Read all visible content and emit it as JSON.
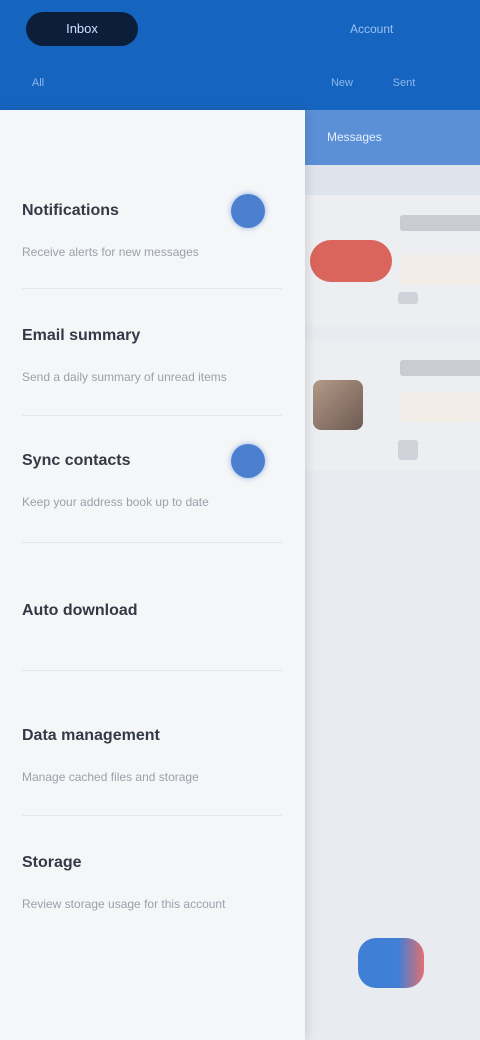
{
  "appbar": {
    "pill_label": "Inbox",
    "right_title": "Account",
    "subtabs": [
      "All",
      "New",
      "Sent"
    ]
  },
  "settings": [
    {
      "title": "Notifications",
      "desc": "Receive alerts for new messages",
      "toggle": true
    },
    {
      "title": "Email summary",
      "desc": "Send a daily summary of unread items",
      "toggle": false
    },
    {
      "title": "Sync contacts",
      "desc": "Keep your address book up to date",
      "toggle": true
    },
    {
      "title": "Auto download",
      "desc": "",
      "toggle": false
    },
    {
      "title": "Data management",
      "desc": "Manage cached files and storage",
      "toggle": false
    },
    {
      "title": "Storage",
      "desc": "Review storage usage for this account",
      "toggle": false
    }
  ],
  "right": {
    "header": "Messages"
  },
  "colors": {
    "primary": "#1565c0",
    "accent": "#4a80cf",
    "alert": "#d9655c"
  }
}
